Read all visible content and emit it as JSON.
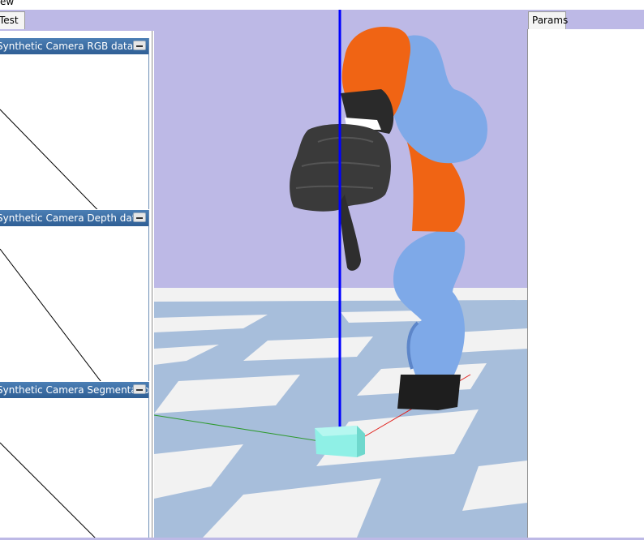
{
  "window": {
    "menu_label": "ew"
  },
  "tabs": {
    "left_tab": "Test",
    "right_tab": "Params"
  },
  "panels": {
    "rgb_title": "Synthetic Camera RGB data",
    "depth_title": "Synthetic Camera Depth data",
    "seg_title": "Synthetic Camera Segmentation Mask"
  },
  "icons": {
    "minimize": "minimize-icon"
  },
  "colors": {
    "sky": "#bdb9e6",
    "floor_dark": "#a7bedb",
    "floor_light": "#f2f2f2",
    "robot_orange": "#f06414",
    "robot_blue": "#7ea9e8",
    "gripper": "#2e2e2e",
    "axis_z": "#0000ff",
    "target_cube": "#8ff0e6"
  }
}
